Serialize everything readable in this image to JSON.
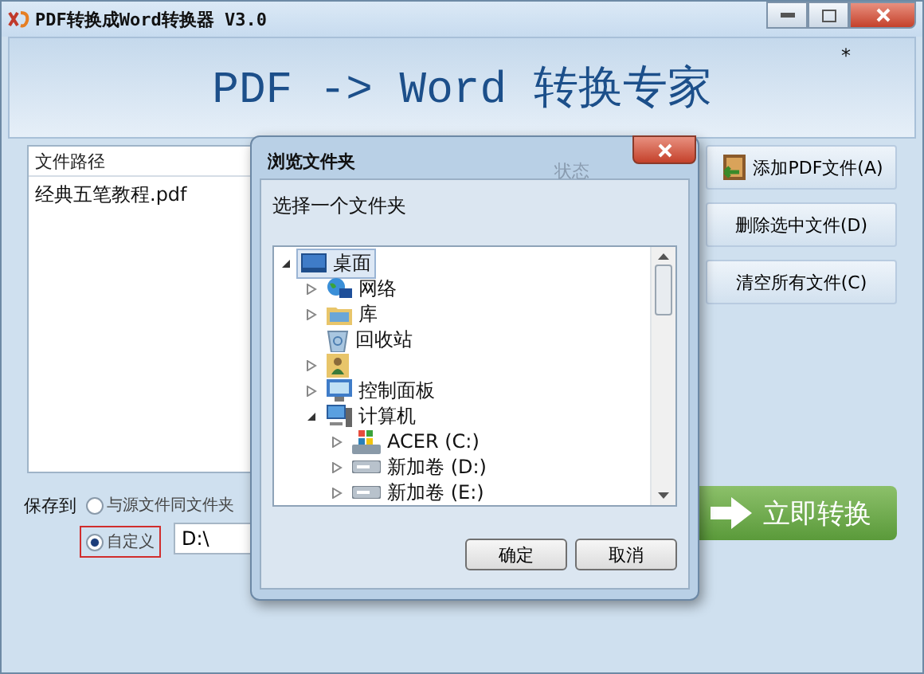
{
  "window": {
    "title": "PDF转换成Word转换器 V3.0"
  },
  "banner": {
    "title": "PDF -> Word 转换专家",
    "mark": "*"
  },
  "file_list": {
    "columns": [
      "文件路径",
      "状态"
    ],
    "rows": [
      {
        "path": "经典五笔教程.pdf"
      }
    ]
  },
  "side_buttons": [
    {
      "label": "添加PDF文件(A)",
      "kind": "add"
    },
    {
      "label": "删除选中文件(D)",
      "kind": "plain"
    },
    {
      "label": "清空所有文件(C)",
      "kind": "plain"
    }
  ],
  "save_to": {
    "label": "保存到",
    "options": [
      {
        "label": "与源文件同文件夹",
        "selected": false,
        "kind": "plain"
      },
      {
        "label": "自定义",
        "selected": true,
        "kind": "boxed"
      }
    ],
    "path": "D:\\"
  },
  "convert_button": {
    "label": "立即转换"
  },
  "dialog": {
    "title": "浏览文件夹",
    "prompt": "选择一个文件夹",
    "tree": [
      {
        "label": "桌面",
        "kind": "desktop",
        "selected": true,
        "expanded": true,
        "children": [
          {
            "label": "网络",
            "kind": "network",
            "selected": false,
            "expanded": false
          },
          {
            "label": "库",
            "kind": "library",
            "selected": false,
            "expanded": false
          },
          {
            "label": "回收站",
            "kind": "recycle",
            "selected": false
          },
          {
            "kind": "user",
            "selected": false,
            "expanded": false
          },
          {
            "label": "控制面板",
            "kind": "control-panel",
            "selected": false,
            "expanded": false
          },
          {
            "label": "计算机",
            "kind": "computer",
            "selected": false,
            "expanded": true,
            "children": [
              {
                "label": "ACER (C:)",
                "kind": "system-drive",
                "selected": false,
                "expanded": false
              },
              {
                "label": "新加卷 (D:)",
                "kind": "drive",
                "selected": false,
                "expanded": false
              },
              {
                "label": "新加卷 (E:)",
                "kind": "drive",
                "selected": false,
                "expanded": false
              }
            ]
          }
        ]
      }
    ],
    "buttons": [
      "确定",
      "取消"
    ]
  }
}
